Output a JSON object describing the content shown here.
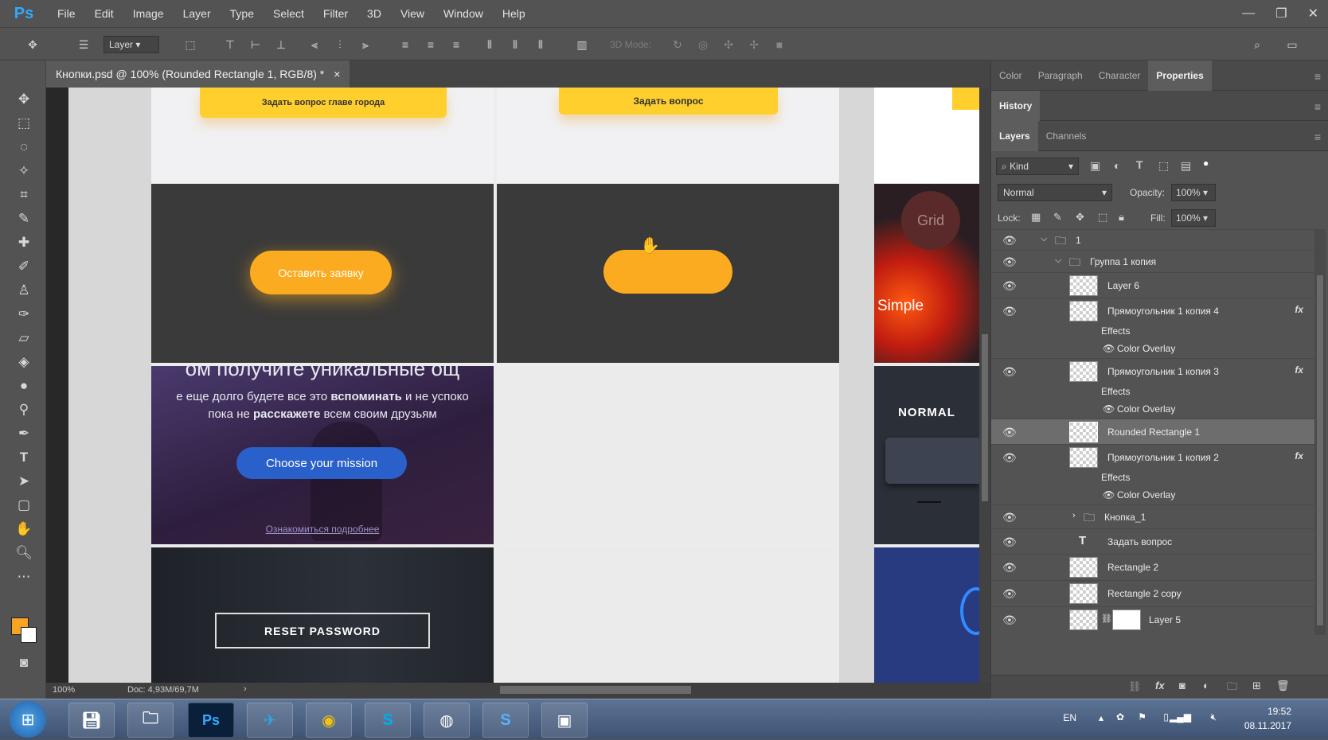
{
  "app": {
    "logo": "Ps"
  },
  "menu": [
    "File",
    "Edit",
    "Image",
    "Layer",
    "Type",
    "Select",
    "Filter",
    "3D",
    "View",
    "Window",
    "Help"
  ],
  "window_controls": [
    "—",
    "❐",
    "✕"
  ],
  "options_bar": {
    "layer_select": "Layer",
    "mode_3d": "3D Mode:"
  },
  "document_tab": {
    "title": "Кнопки.psd @ 100% (Rounded Rectangle 1, RGB/8) *",
    "close": "×"
  },
  "canvas": {
    "btn_top_left": "Задать вопрос главе города",
    "btn_top_mid": "Задать вопрос",
    "btn_orange": "Оставить заявку",
    "grid_label": "Grid",
    "simple_label": "Simple",
    "normal_label": "NORMAL",
    "overlay_line1": "ом получите уникальные ощ",
    "overlay_line2a": "е еще долго будете все это ",
    "overlay_line2b": "вспоминать",
    "overlay_line2c": " и не успоко",
    "overlay_line3a": "пока не ",
    "overlay_line3b": "расскажете",
    "overlay_line3c": " всем своим друзьям",
    "btn_mission": "Choose your mission",
    "link_text": "Ознакомиться подробнее",
    "btn_reset": "RESET PASSWORD"
  },
  "status": {
    "zoom": "100%",
    "doc": "Doc: 4,93M/69,7M"
  },
  "panels": {
    "top_tabs": [
      "Color",
      "Paragraph",
      "Character",
      "Properties"
    ],
    "history_tab": "History",
    "layer_tabs": [
      "Layers",
      "Channels"
    ],
    "filter_kind": "Kind",
    "blend_mode": "Normal",
    "opacity_label": "Opacity:",
    "opacity_value": "100%",
    "lock_label": "Lock:",
    "fill_label": "Fill:",
    "fill_value": "100%"
  },
  "layers": [
    {
      "name": "1",
      "type": "group",
      "indent": 0
    },
    {
      "name": "Группа 1 копия",
      "type": "group",
      "indent": 1
    },
    {
      "name": "Layer 6",
      "type": "pixel"
    },
    {
      "name": "Прямоугольник 1 копия 4",
      "type": "shape",
      "fx": "fx",
      "effects": "Effects",
      "effect": "Color Overlay"
    },
    {
      "name": "Прямоугольник 1 копия 3",
      "type": "shape",
      "fx": "fx",
      "effects": "Effects",
      "effect": "Color Overlay"
    },
    {
      "name": "Rounded Rectangle 1",
      "type": "shape",
      "selected": true
    },
    {
      "name": "Прямоугольник 1 копия 2",
      "type": "shape",
      "fx": "fx",
      "effects": "Effects",
      "effect": "Color Overlay"
    },
    {
      "name": "Кнопка_1",
      "type": "group"
    },
    {
      "name": "Задать вопрос",
      "type": "text"
    },
    {
      "name": "Rectangle 2",
      "type": "shape"
    },
    {
      "name": "Rectangle 2 copy",
      "type": "shape"
    },
    {
      "name": "Layer 5",
      "type": "masked"
    }
  ],
  "taskbar": {
    "apps": [
      "start",
      "save",
      "explorer",
      "photoshop",
      "telegram",
      "chrome",
      "skype",
      "obs",
      "app-s",
      "photos"
    ],
    "ps_label": "Ps",
    "lang": "EN",
    "time": "19:52",
    "date": "08.11.2017"
  },
  "colors": {
    "accent_orange": "#f7a424",
    "blue_button": "#2a60c9",
    "foreground_swatch": "#f7a424"
  }
}
